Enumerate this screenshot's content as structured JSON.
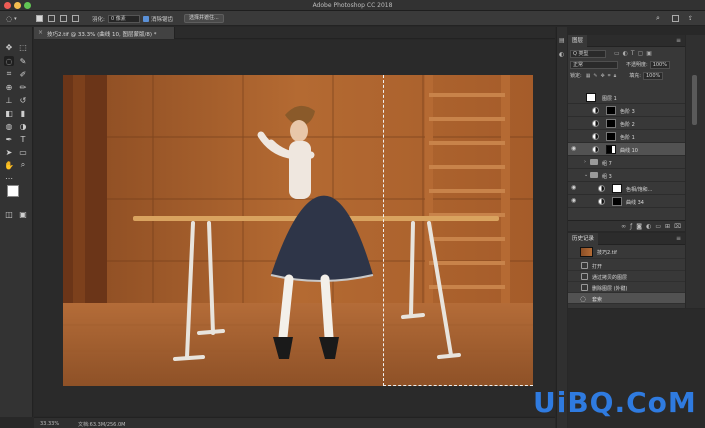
{
  "window": {
    "title": "Adobe Photoshop CC 2018"
  },
  "options_bar": {
    "feather_label": "羽化:",
    "feather_value": "0 像素",
    "antialias_label": "消除锯齿",
    "select_mask_button": "选择并遮住..."
  },
  "document": {
    "tab_title": "技巧2.tif @ 33.3% (曲线 10, 图层蒙版/8) *",
    "zoom": "33.33%",
    "doc_info": "文档:63.3M/256.0M"
  },
  "layers_panel": {
    "tab": "图层",
    "filter_kind": "Q 类型",
    "blend_mode": "正常",
    "opacity_label": "不透明度:",
    "opacity_value": "100%",
    "lock_label": "锁定:",
    "fill_label": "填充:",
    "fill_value": "100%",
    "layers": [
      {
        "name": "图层 1",
        "type": "pixel"
      },
      {
        "name": "色阶 3",
        "type": "adjust"
      },
      {
        "name": "色阶 2",
        "type": "adjust"
      },
      {
        "name": "色阶 1",
        "type": "adjust"
      },
      {
        "name": "曲线 10",
        "type": "adjust",
        "selected": true
      },
      {
        "name": "组 7",
        "type": "group"
      },
      {
        "name": "组 3",
        "type": "group"
      },
      {
        "name": "色相/饱和...",
        "type": "adjust"
      },
      {
        "name": "曲线 34",
        "type": "adjust"
      }
    ]
  },
  "history_panel": {
    "tab": "历史记录",
    "snapshot": "技巧2.tif",
    "items": [
      {
        "label": "打开"
      },
      {
        "label": "通过拷贝的图层"
      },
      {
        "label": "删除图层 (外键)"
      },
      {
        "label": "套索",
        "selected": true
      }
    ]
  },
  "watermark": "UiBQ.CoM"
}
